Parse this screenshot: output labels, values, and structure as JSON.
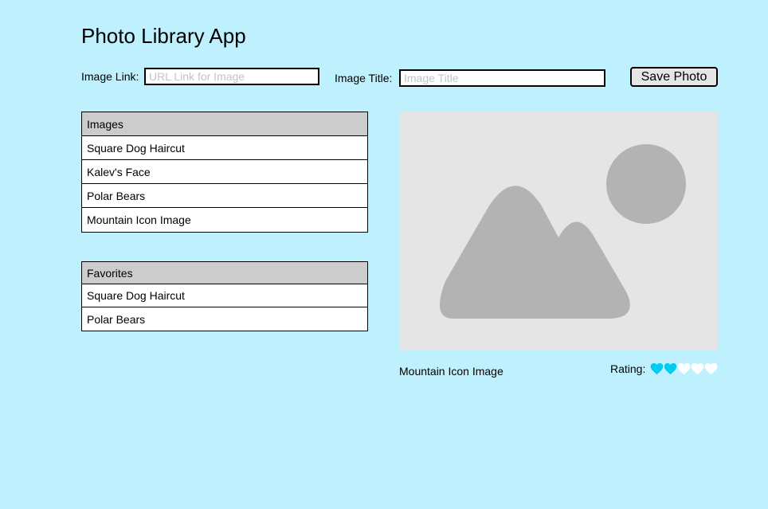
{
  "app": {
    "title": "Photo Library App"
  },
  "form": {
    "image_link_label": "Image Link:",
    "image_link_placeholder": "URL Link for Image",
    "image_link_value": "",
    "image_title_label": "Image Title:",
    "image_title_placeholder": "Image Title",
    "image_title_value": "",
    "save_label": "Save Photo"
  },
  "images": {
    "header": "Images",
    "items": [
      {
        "label": "Square Dog Haircut"
      },
      {
        "label": "Kalev's Face"
      },
      {
        "label": "Polar Bears"
      },
      {
        "label": "Mountain Icon Image"
      }
    ]
  },
  "favorites": {
    "header": "Favorites",
    "items": [
      {
        "label": "Square Dog Haircut"
      },
      {
        "label": "Polar Bears"
      }
    ]
  },
  "preview": {
    "icon": "mountain-image-placeholder-icon",
    "caption": "Mountain Icon Image",
    "rating_label": "Rating:",
    "rating": 2,
    "rating_max": 5
  },
  "colors": {
    "background": "#bef1fd",
    "heart_filled": "#00ccee",
    "heart_empty": "#ffffff",
    "list_header": "#cccccc",
    "preview_bg": "#e5e5e5",
    "placeholder_shape": "#b3b3b3"
  }
}
